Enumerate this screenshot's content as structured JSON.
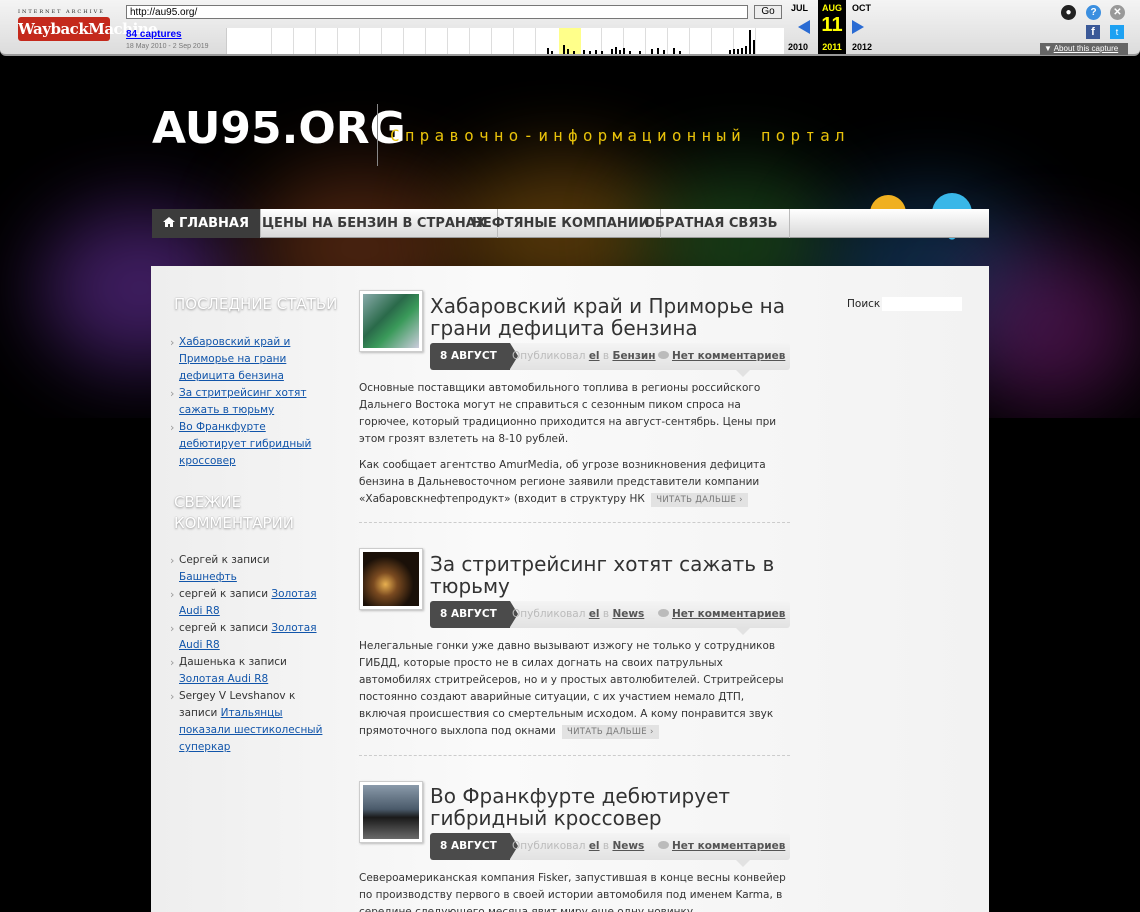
{
  "wayback": {
    "logo_top": "INTERNET ARCHIVE",
    "logo_main": "WaybackMachine",
    "url": "http://au95.org/",
    "go_label": "Go",
    "captures_label": "84 captures",
    "date_range": "18 May 2010 - 2 Sep 2019",
    "prev_month": "JUL",
    "current_month": "AUG",
    "next_month": "OCT",
    "current_day": "11",
    "prev_year": "2010",
    "current_year": "2011",
    "next_year": "2012",
    "about_label": "About this capture",
    "colors": {
      "logo": "#c4291c",
      "arrow": "#2a6bd3",
      "highlight": "#ffff8a"
    }
  },
  "site": {
    "title": "AU95.ORG",
    "tagline": "Справочно-информационный портал"
  },
  "nav": {
    "items": [
      {
        "label": "ГЛАВНАЯ",
        "active": true
      },
      {
        "label": "ЦЕНЫ НА БЕНЗИН В СТРАНАХ"
      },
      {
        "label": "НЕФТЯНЫЕ КОМПАНИИ"
      },
      {
        "label": "ОБРАТНАЯ СВЯЗЬ"
      }
    ]
  },
  "sidebar": {
    "recent_heading": "ПОСЛЕДНИЕ СТАТЬИ",
    "recent": [
      "Хабаровский край и Приморье на грани дефицита бензина",
      "За стритрейсинг хотят сажать в тюрьму",
      "Во Франкфурте дебютирует гибридный кроссовер"
    ],
    "comments_heading": "СВЕЖИЕ КОММЕНТАРИИ",
    "comments": [
      {
        "author": "Сергей",
        "sep": " к записи ",
        "post": "Башнефть"
      },
      {
        "author": "сергей",
        "sep": " к записи ",
        "post": "Золотая Audi R8"
      },
      {
        "author": "сергей",
        "sep": " к записи ",
        "post": "Золотая Audi R8"
      },
      {
        "author": "Дашенька",
        "sep": " к записи ",
        "post": "Золотая Audi R8"
      },
      {
        "author": "Sergey V Levshanov",
        "sep": " к записи ",
        "post": "Итальянцы показали шестиколесный суперкар"
      }
    ]
  },
  "search": {
    "label": "Поиск"
  },
  "posts": [
    {
      "title": "Хабаровский край и Приморье на грани дефицита бензина",
      "date": "8 АВГУСТ",
      "published_by": "Опубликовал",
      "author": "el",
      "in_word": "в",
      "category": "Бензин",
      "comments": "Нет комментариев",
      "p1": "Основные поставщики автомобильного топлива в регионы российского Дальнего Востока могут не справиться с сезонным пиком спроса на горючее, который традиционно приходится на август-сентябрь. Цены при этом грозят взлететь на 8-10 рублей.",
      "p2": "Как сообщает агентство AmurMedia, об угрозе возникновения дефицита бензина в Дальневосточном регионе заявили представители компании «Хабаровскнефтепродукт» (входит в структуру НК",
      "more": "ЧИТАТЬ ДАЛЬШЕ ›"
    },
    {
      "title": "За стритрейсинг хотят сажать в тюрьму",
      "date": "8 АВГУСТ",
      "published_by": "Опубликовал",
      "author": "el",
      "in_word": "в",
      "category": "News",
      "comments": "Нет комментариев",
      "p1": "Нелегальные гонки уже давно вызывают изжогу не только у сотрудников ГИБДД, которые просто не в силах догнать на своих патрульных автомобилях стритрейсеров, но и у простых автолюбителей. Стритрейсеры постоянно создают аварийные ситуации, с их участием немало ДТП, включая происшествия со смертельным исходом. А кому понравится звук прямоточного выхлопа под окнами",
      "more": "ЧИТАТЬ ДАЛЬШЕ ›"
    },
    {
      "title": "Во Франкфурте дебютирует гибридный кроссовер",
      "date": "8 АВГУСТ",
      "published_by": "Опубликовал",
      "author": "el",
      "in_word": "в",
      "category": "News",
      "comments": "Нет комментариев",
      "p1": "Североамериканская компания Fisker, запустившая в конце весны конвейер по производству первого в своей истории автомобиля под именем Karma, в середине следующего месяца явит миру еще одну новинку"
    }
  ]
}
